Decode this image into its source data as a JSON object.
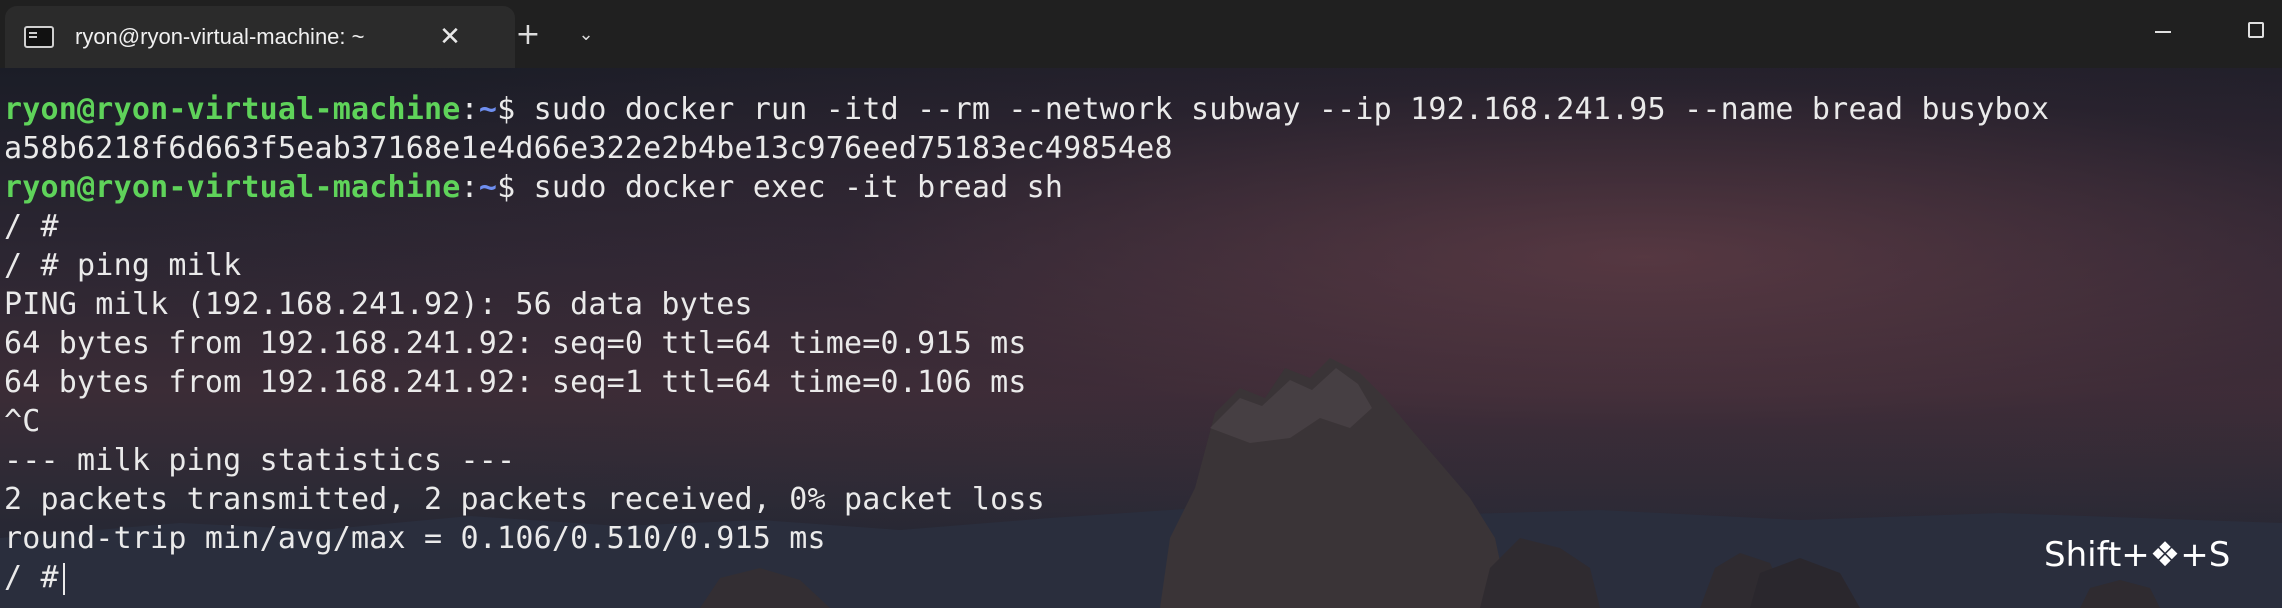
{
  "window": {
    "tab_title": "ryon@ryon-virtual-machine: ~",
    "tab_close_icon": "close-icon",
    "new_tab_icon": "plus-icon",
    "dropdown_icon": "chevron-down-icon",
    "minimize_icon": "minimize-icon",
    "maximize_icon": "maximize-icon"
  },
  "terminal": {
    "prompt_user": "ryon@ryon-virtual-machine",
    "prompt_colon": ":",
    "prompt_path": "~",
    "prompt_symbol": "$ ",
    "cmd1": "sudo docker run -itd --rm --network subway --ip 192.168.241.95 --name bread busybox",
    "out_container_id": "a58b6218f6d663f5eab37168e1e4d66e322e2b4be13c976eed75183ec49854e8",
    "cmd2": "sudo docker exec -it bread sh",
    "line_shell1": "/ #",
    "line_ping_cmd": "/ # ping milk",
    "line_ping_header": "PING milk (192.168.241.92): 56 data bytes",
    "line_reply1": "64 bytes from 192.168.241.92: seq=0 ttl=64 time=0.915 ms",
    "line_reply2": "64 bytes from 192.168.241.92: seq=1 ttl=64 time=0.106 ms",
    "line_ctrl_c": "^C",
    "line_stats_header": "--- milk ping statistics ---",
    "line_stats_packets": "2 packets transmitted, 2 packets received, 0% packet loss",
    "line_stats_rtt": "round-trip min/avg/max = 0.106/0.510/0.915 ms",
    "line_shell_current": "/ #"
  },
  "overlay": {
    "shortcut_hint": "Shift+❖+S"
  },
  "colors": {
    "prompt_user": "#5fd35a",
    "prompt_path": "#6f8ff0",
    "text": "#eaeaea",
    "titlebar": "#202020"
  }
}
